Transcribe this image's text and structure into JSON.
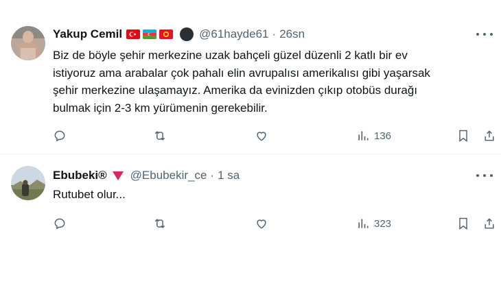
{
  "tweets": [
    {
      "name": "Yakup Cemil",
      "handle": "@61hayde61",
      "separator": "·",
      "time": "26sn",
      "text_lines": [
        "Biz de böyle şehir merkezine uzak bahçeli güzel düzenli 2 katlı bir ev",
        "istiyoruz ama arabalar çok pahalı elin avrupalısı amerikalısı gibi yaşarsak",
        "şehir merkezine ulaşamayız. Amerika da evinizden çıkıp otobüs durağı",
        "bulmak için 2-3 km yürümenin gerekebilir."
      ],
      "flags": [
        "flag-turkey",
        "flag-azerbaijan",
        "flag-kyrgyzstan"
      ],
      "views": "136"
    },
    {
      "name": "Ebubeki®",
      "handle": "@Ebubekir_ce",
      "separator": "·",
      "time": "1 sa",
      "text_lines": [
        "Rutubet olur..."
      ],
      "views": "323"
    }
  ],
  "colors": {
    "text": "#0f1419",
    "secondary": "#536471",
    "divider": "#eff3f4",
    "badge_red": "#e0245e"
  }
}
